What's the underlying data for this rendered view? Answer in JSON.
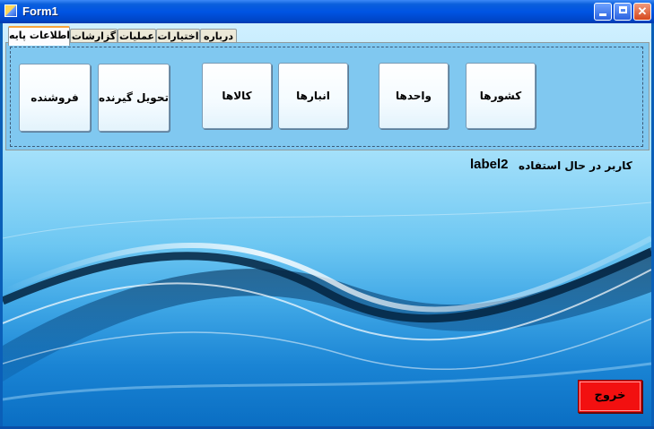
{
  "window": {
    "title": "Form1",
    "minimize_icon": "minimize-icon",
    "maximize_icon": "maximize-icon",
    "close_icon": "close-icon",
    "close_glyph": "✕"
  },
  "tabs": [
    {
      "label": "اطلاعات پایه",
      "active": true
    },
    {
      "label": "گزارشات",
      "active": false
    },
    {
      "label": "عملیات",
      "active": false
    },
    {
      "label": "اختیارات",
      "active": false
    },
    {
      "label": "درباره",
      "active": false
    }
  ],
  "buttons": {
    "sellers": "فروشنده",
    "receivers": "تحویل گیرنده",
    "goods": "کالاها",
    "warehouses": "انبارها",
    "units": "واحدها",
    "countries": "کشورها"
  },
  "user": {
    "caption": "کاربر در حال استفاده",
    "value": "label2"
  },
  "exit_label": "خروج",
  "colors": {
    "titlebar": "#0054e3",
    "exit": "#f21010",
    "active_tab_accent": "#f7a43c"
  }
}
